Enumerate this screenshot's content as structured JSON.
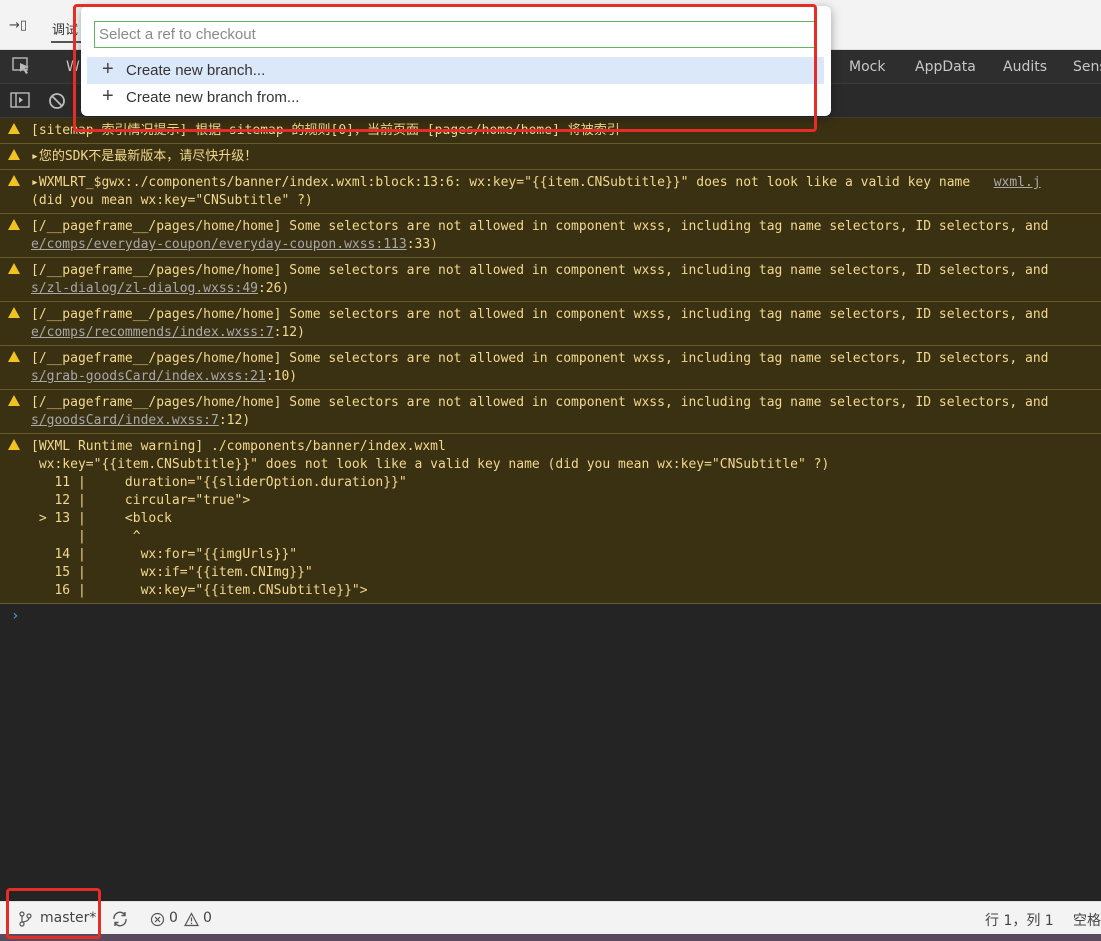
{
  "topbar": {
    "collapse_icon": "→▯",
    "tab_label": "调试"
  },
  "devtools_tabs": {
    "partial_left": "W",
    "tabs": [
      "Mock",
      "AppData",
      "Audits",
      "Sens"
    ]
  },
  "checkout": {
    "placeholder": "Select a ref to checkout",
    "options": [
      "Create new branch...",
      "Create new branch from..."
    ]
  },
  "console": {
    "warnings": [
      {
        "lines": [
          {
            "text": "[sitemap 索引情况提示] 根据 sitemap 的规则[0]，当前页面 [pages/home/home] 将被索引"
          }
        ]
      },
      {
        "lines": [
          {
            "text": "▸您的SDK不是最新版本，请尽快升级！"
          }
        ]
      },
      {
        "lines": [
          {
            "text": "▸WXMLRT_$gwx:./components/banner/index.wxml:block:13:6: wx:key=\"{{item.CNSubtitle}}\" does not look like a valid key name",
            "link": "wxml.j"
          },
          {
            "text": "(did you mean wx:key=\"CNSubtitle\" ?)"
          }
        ]
      },
      {
        "lines": [
          {
            "text": "[/__pageframe__/pages/home/home] Some selectors are not allowed in component wxss, including tag name selectors, ID selectors, and"
          },
          {
            "link": "e/comps/everyday-coupon/everyday-coupon.wxss:113",
            "text": ":33)"
          }
        ]
      },
      {
        "lines": [
          {
            "text": "[/__pageframe__/pages/home/home] Some selectors are not allowed in component wxss, including tag name selectors, ID selectors, and"
          },
          {
            "link": "s/zl-dialog/zl-dialog.wxss:49",
            "text": ":26)"
          }
        ]
      },
      {
        "lines": [
          {
            "text": "[/__pageframe__/pages/home/home] Some selectors are not allowed in component wxss, including tag name selectors, ID selectors, and"
          },
          {
            "link": "e/comps/recommends/index.wxss:7",
            "text": ":12)"
          }
        ]
      },
      {
        "lines": [
          {
            "text": "[/__pageframe__/pages/home/home] Some selectors are not allowed in component wxss, including tag name selectors, ID selectors, and"
          },
          {
            "link": "s/grab-goodsCard/index.wxss:21",
            "text": ":10)"
          }
        ]
      },
      {
        "lines": [
          {
            "text": "[/__pageframe__/pages/home/home] Some selectors are not allowed in component wxss, including tag name selectors, ID selectors, and"
          },
          {
            "link": "s/goodsCard/index.wxss:7",
            "text": ":12)"
          }
        ]
      },
      {
        "lines": [
          {
            "text": "[WXML Runtime warning] ./components/banner/index.wxml"
          },
          {
            "text": " wx:key=\"{{item.CNSubtitle}}\" does not look like a valid key name (did you mean wx:key=\"CNSubtitle\" ?)"
          },
          {
            "text": "   11 |     duration=\"{{sliderOption.duration}}\""
          },
          {
            "text": "   12 |     circular=\"true\">"
          },
          {
            "text": " > 13 |     <block"
          },
          {
            "text": "      |      ^"
          },
          {
            "text": "   14 |       wx:for=\"{{imgUrls}}\""
          },
          {
            "text": "   15 |       wx:if=\"{{item.CNImg}}\""
          },
          {
            "text": "   16 |       wx:key=\"{{item.CNSubtitle}}\">"
          }
        ]
      }
    ],
    "prompt": "›"
  },
  "statusbar": {
    "branch": "master*",
    "errors": "0",
    "warnings": "0",
    "position": "行 1，列 1",
    "spaces": "空格"
  },
  "colors": {
    "highlight": "#e52d27",
    "warning_bg": "#3a3012",
    "warning_text": "#f3d88e"
  }
}
